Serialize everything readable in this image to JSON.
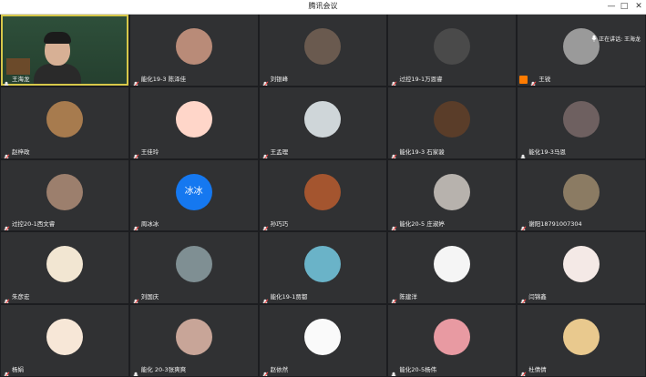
{
  "window": {
    "title": "腾讯会议",
    "controls": [
      "—",
      "□",
      "✕"
    ]
  },
  "speaking_indicator": "正在讲话: 王海龙",
  "participants": [
    {
      "name": "王海龙",
      "video": true,
      "muted": false,
      "active": true
    },
    {
      "name": "能化19-3 陈泽佳",
      "muted": true,
      "avatar_color": "#b98b78"
    },
    {
      "name": "刘银峰",
      "muted": true,
      "avatar_color": "#6a5a4f"
    },
    {
      "name": "过控19-1万恩睿",
      "muted": true,
      "avatar_color": "#4a4a4a"
    },
    {
      "name": "王锐",
      "muted": true,
      "sharing": true,
      "avatar_color": "#9a9a9a"
    },
    {
      "name": "赵梓政",
      "muted": true,
      "avatar_color": "#a77b4e"
    },
    {
      "name": "王佳玲",
      "muted": true,
      "avatar_color": "#ffd6c9"
    },
    {
      "name": "王孟理",
      "muted": true,
      "avatar_color": "#cfd6d9"
    },
    {
      "name": "能化19-3 石家骏",
      "muted": true,
      "avatar_color": "#5a3d29"
    },
    {
      "name": "能化19-3马恩",
      "muted": false,
      "avatar_color": "#6e6060"
    },
    {
      "name": "过控20-1西文睿",
      "muted": true,
      "avatar_color": "#9c7f6d"
    },
    {
      "name": "周冰冰",
      "muted": true,
      "avatar_text": "冰冰"
    },
    {
      "name": "孙巧巧",
      "muted": true,
      "avatar_color": "#a4552f"
    },
    {
      "name": "能化20-5 庄淑婷",
      "muted": true,
      "avatar_color": "#b7b2ad"
    },
    {
      "name": "谢阳18791007304",
      "muted": true,
      "avatar_color": "#8b7b63"
    },
    {
      "name": "朱彦宏",
      "muted": true,
      "avatar_color": "#f2e6d2"
    },
    {
      "name": "刘国庆",
      "muted": true,
      "avatar_color": "#7f8f93"
    },
    {
      "name": "能化19-1贾都",
      "muted": true,
      "avatar_color": "#6ab3c8"
    },
    {
      "name": "陈建洋",
      "muted": true,
      "avatar_color": "#f5f5f5"
    },
    {
      "name": "闫锦鑫",
      "muted": true,
      "avatar_color": "#f4e9e6"
    },
    {
      "name": "杨娟",
      "muted": true,
      "avatar_color": "#f7e7d7"
    },
    {
      "name": "能化 20-3张爽爽",
      "muted": false,
      "avatar_color": "#c8a598"
    },
    {
      "name": "赵依然",
      "muted": true,
      "avatar_color": "#fafafa"
    },
    {
      "name": "能化20-5杨伟",
      "muted": false,
      "avatar_color": "#e89aa2"
    },
    {
      "name": "杜倩倩",
      "muted": true,
      "avatar_color": "#e9c98e"
    }
  ]
}
